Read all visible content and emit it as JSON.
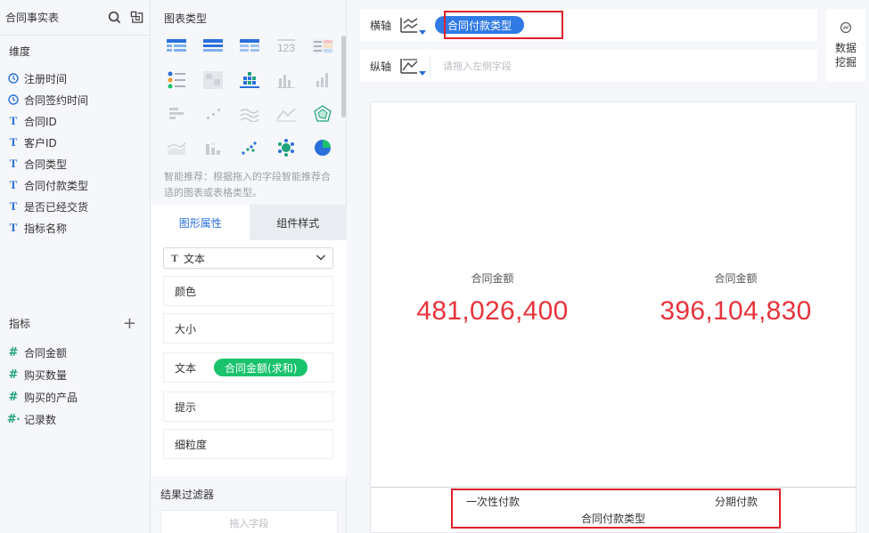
{
  "left_panel": {
    "title": "合同事实表",
    "dimensions_title": "维度",
    "dimensions": [
      {
        "label": "注册时间",
        "type": "time"
      },
      {
        "label": "合同签约时间",
        "type": "time"
      },
      {
        "label": "合同ID",
        "type": "text"
      },
      {
        "label": "客户ID",
        "type": "text"
      },
      {
        "label": "合同类型",
        "type": "text"
      },
      {
        "label": "合同付款类型",
        "type": "text"
      },
      {
        "label": "是否已经交货",
        "type": "text"
      },
      {
        "label": "指标名称",
        "type": "text"
      }
    ],
    "measures_title": "指标",
    "measures": [
      {
        "label": "合同金额",
        "type": "number"
      },
      {
        "label": "购买数量",
        "type": "number"
      },
      {
        "label": "购买的产品",
        "type": "number"
      },
      {
        "label": "记录数",
        "type": "count"
      }
    ],
    "add_icon": "plus-icon"
  },
  "middle_panel": {
    "chart_types_title": "图表类型",
    "chart_type_icon": "123",
    "hint": "智能推荐：根据拖入的字段智能推荐合适的图表或表格类型。",
    "tabs": [
      "图形属性",
      "组件样式"
    ],
    "mark_select": "文本",
    "properties": {
      "color": "颜色",
      "size": "大小",
      "text": "文本",
      "text_field": "合同金额(求和)",
      "tooltip": "提示",
      "granularity": "细粒度"
    },
    "filter_title": "结果过滤器",
    "filter_placeholder": "拖入字段"
  },
  "axes": {
    "x_label": "横轴",
    "x_field": "合同付款类型",
    "y_label": "纵轴",
    "y_placeholder": "请拖入左侧字段"
  },
  "mining": {
    "line1": "数据",
    "line2": "挖掘"
  },
  "canvas": {
    "kpis": [
      {
        "label": "合同金额",
        "value": "481,026,400"
      },
      {
        "label": "合同金额",
        "value": "396,104,830"
      }
    ],
    "categories": [
      "一次性付款",
      "分期付款"
    ],
    "x_axis_title": "合同付款类型"
  },
  "colors": {
    "accent": "#2f7ae5",
    "value_red": "#e8343c",
    "highlight": "#e0202a",
    "pill_green": "#19c36b"
  }
}
